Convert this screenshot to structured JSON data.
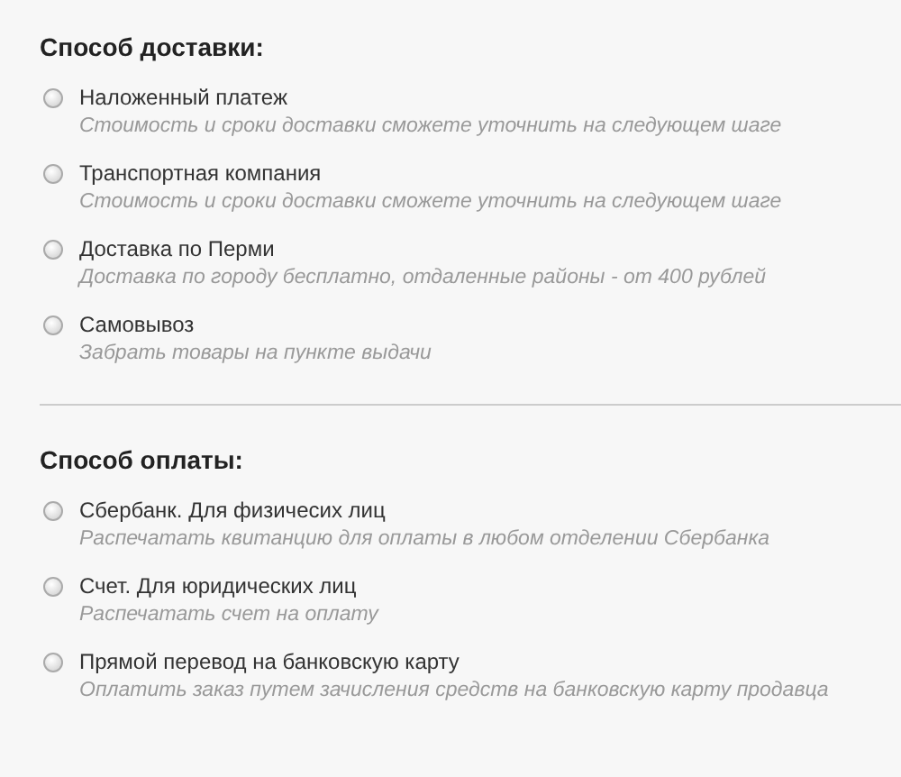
{
  "sections": [
    {
      "title": "Способ доставки:",
      "options": [
        {
          "label": "Наложенный платеж",
          "description": "Стоимость и сроки доставки сможете уточнить на следующем шаге",
          "selected": false
        },
        {
          "label": "Транспортная компания",
          "description": "Стоимость и сроки доставки сможете уточнить на следующем шаге",
          "selected": false
        },
        {
          "label": "Доставка по Перми",
          "description": "Доставка по городу бесплатно, отдаленные районы - от 400 рублей",
          "selected": false
        },
        {
          "label": "Самовывоз",
          "description": "Забрать товары на пункте выдачи",
          "selected": false
        }
      ]
    },
    {
      "title": "Способ оплаты:",
      "options": [
        {
          "label": "Сбербанк. Для физичесих лиц",
          "description": "Распечатать квитанцию для оплаты в любом отделении Сбербанка",
          "selected": false
        },
        {
          "label": "Счет. Для юридических лиц",
          "description": "Распечатать счет на оплату",
          "selected": false
        },
        {
          "label": "Прямой перевод на банковскую карту",
          "description": "Оплатить заказ путем зачисления средств на банковскую карту продавца",
          "selected": false
        }
      ]
    }
  ]
}
